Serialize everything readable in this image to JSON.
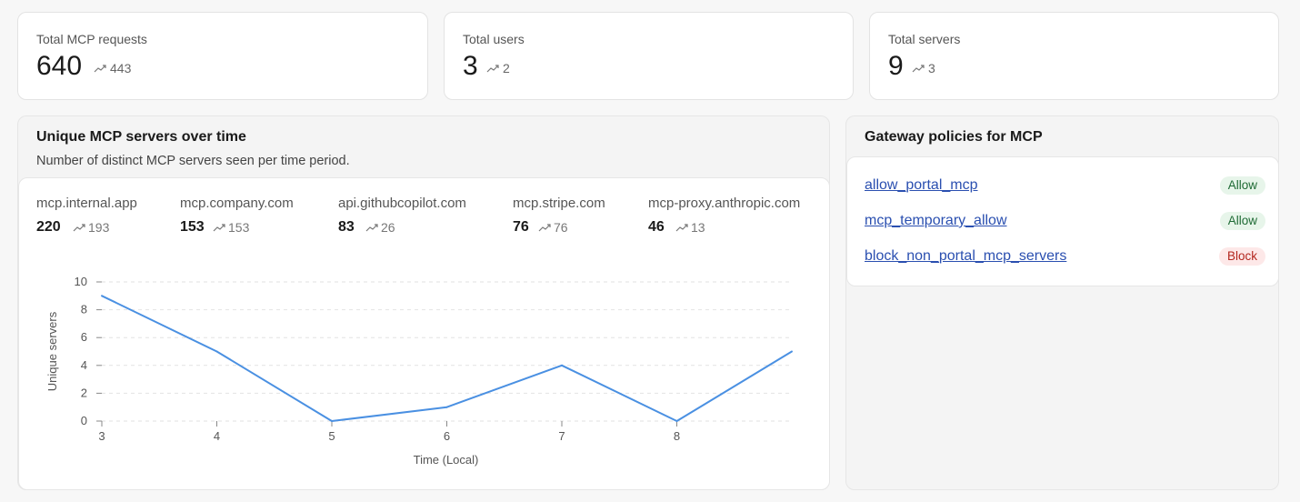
{
  "stats": [
    {
      "label": "Total MCP requests",
      "value": "640",
      "delta": "443"
    },
    {
      "label": "Total users",
      "value": "3",
      "delta": "2"
    },
    {
      "label": "Total servers",
      "value": "9",
      "delta": "3"
    }
  ],
  "servers_panel": {
    "title": "Unique MCP servers over time",
    "subtitle": "Number of distinct MCP servers seen per time period.",
    "servers": [
      {
        "name": "mcp.internal.app",
        "count": "220",
        "delta": "193"
      },
      {
        "name": "mcp.company.com",
        "count": "153",
        "delta": "153"
      },
      {
        "name": "api.githubcopilot.com",
        "count": "83",
        "delta": "26"
      },
      {
        "name": "mcp.stripe.com",
        "count": "76",
        "delta": "76"
      },
      {
        "name": "mcp-proxy.anthropic.com",
        "count": "46",
        "delta": "13"
      }
    ]
  },
  "policies_panel": {
    "title": "Gateway policies for MCP",
    "policies": [
      {
        "name": "allow_portal_mcp",
        "action": "Allow",
        "kind": "allow"
      },
      {
        "name": "mcp_temporary_allow",
        "action": "Allow",
        "kind": "allow"
      },
      {
        "name": "block_non_portal_mcp_servers",
        "action": "Block",
        "kind": "block"
      }
    ]
  },
  "chart_data": {
    "type": "line",
    "x": [
      3,
      4,
      5,
      6,
      7,
      8,
      9
    ],
    "x_ticks": [
      "3",
      "4",
      "5",
      "6",
      "7",
      "8"
    ],
    "series": [
      {
        "values": [
          9,
          5,
          0,
          1,
          4,
          0,
          5
        ],
        "color": "#4a90e2"
      }
    ],
    "xlabel": "Time (Local)",
    "ylabel": "Unique servers",
    "y_ticks": [
      0,
      2,
      4,
      6,
      8,
      10
    ],
    "ylim": [
      0,
      10
    ],
    "grid": "horizontal dashed"
  },
  "colors": {
    "accent": "#4a90e2",
    "link": "#2a4fb0",
    "allow_bg": "#e7f5ea",
    "allow_text": "#1f6b35",
    "block_bg": "#fde8e8",
    "block_text": "#b3261e"
  },
  "icons": {
    "trend": "trending-up-icon"
  }
}
